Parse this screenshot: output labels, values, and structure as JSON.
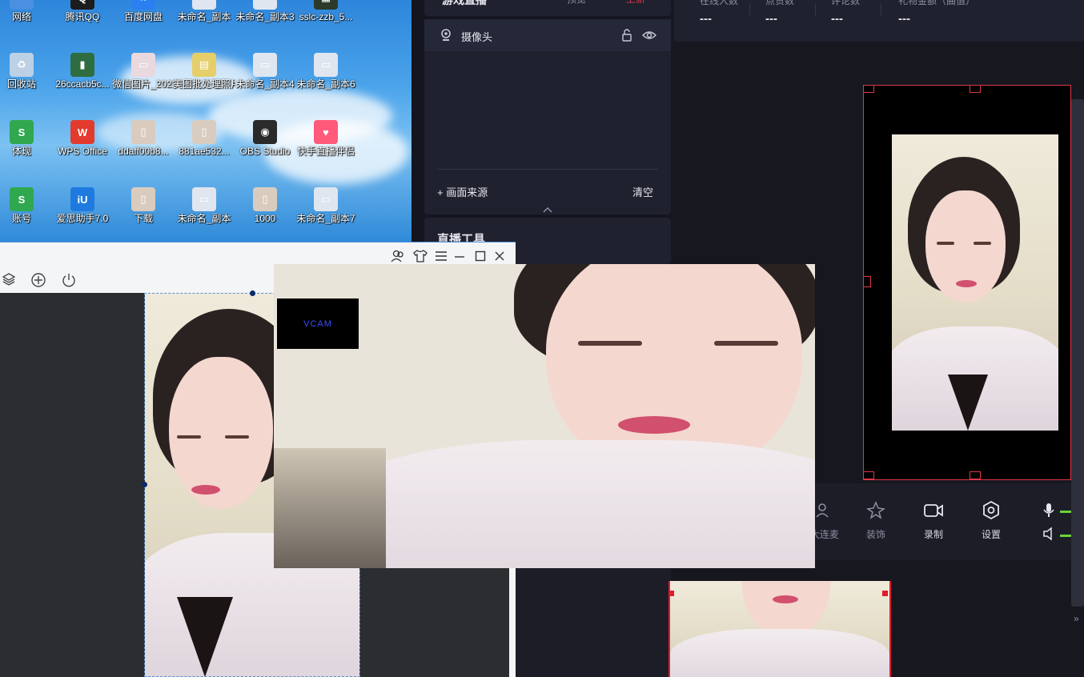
{
  "desktop": {
    "icons": [
      {
        "label": "网络",
        "glyph": "▭",
        "color": "#4b8fe0"
      },
      {
        "label": "腾讯QQ",
        "glyph": "Q",
        "color": "#1c1c1c"
      },
      {
        "label": "百度网盘",
        "glyph": "∞",
        "color": "#2b7ff0"
      },
      {
        "label": "未命名_副本",
        "glyph": "▭",
        "color": "#dfe6ef"
      },
      {
        "label": "未命名_副本3",
        "glyph": "▭",
        "color": "#dfe6ef"
      },
      {
        "label": "sslc-zzb_5...",
        "glyph": "▦",
        "color": "#2d3a2a"
      },
      {
        "label": "回收站",
        "glyph": "♻",
        "color": "#bcd0e6"
      },
      {
        "label": "26ccacb5c...",
        "glyph": "▮",
        "color": "#2e6d3f"
      },
      {
        "label": "微信图片_2022051...",
        "glyph": "▭",
        "color": "#e9d8dd"
      },
      {
        "label": "美图批处理照片",
        "glyph": "▤",
        "color": "#e6cf6a"
      },
      {
        "label": "未命名_副本4",
        "glyph": "▭",
        "color": "#dfe6ef"
      },
      {
        "label": "未命名_副本6",
        "glyph": "▭",
        "color": "#dfe6ef"
      },
      {
        "label": "体现",
        "glyph": "S",
        "color": "#2fa84f"
      },
      {
        "label": "WPS Office",
        "glyph": "W",
        "color": "#e23b2e"
      },
      {
        "label": "ddaff00b8...",
        "glyph": "▯",
        "color": "#d9ccbf"
      },
      {
        "label": "881ae532...",
        "glyph": "▯",
        "color": "#d9ccbf"
      },
      {
        "label": "OBS Studio",
        "glyph": "◉",
        "color": "#2a2a2a"
      },
      {
        "label": "快手直播伴侣",
        "glyph": "♥",
        "color": "#ff5a7a"
      },
      {
        "label": "账号",
        "glyph": "S",
        "color": "#2fa84f"
      },
      {
        "label": "爱思助手7.0",
        "glyph": "iU",
        "color": "#1f7ae0"
      },
      {
        "label": "下载",
        "glyph": "▯",
        "color": "#d9ccbf"
      },
      {
        "label": "未命名_副本",
        "glyph": "▭",
        "color": "#dfe6ef"
      },
      {
        "label": "1000",
        "glyph": "▯",
        "color": "#d9ccbf"
      },
      {
        "label": "未命名_副本7",
        "glyph": "▭",
        "color": "#dfe6ef"
      }
    ]
  },
  "live_panel": {
    "scene_title": "游戏直播",
    "scene_btn1": "预览",
    "scene_btn2": "上新",
    "source_item": "摄像头",
    "add_source": "+ 画面来源",
    "clear": "清空",
    "tools_title": "直播工具"
  },
  "stats": [
    {
      "key": "在线人数",
      "value": "---"
    },
    {
      "key": "点赞数",
      "value": "---"
    },
    {
      "key": "评论数",
      "value": "---"
    },
    {
      "key": "礼物金额（曲值）",
      "value": "---"
    }
  ],
  "toolbar": {
    "lianmai": "大连麦",
    "zhuangshi": "装饰",
    "luzhi": "录制",
    "shezhi": "设置"
  },
  "vcam": {
    "badge": "VCAM"
  },
  "colors": {
    "accent_red": "#e0364a",
    "panel_bg": "#1f212f",
    "volume_green": "#6bd23a"
  }
}
